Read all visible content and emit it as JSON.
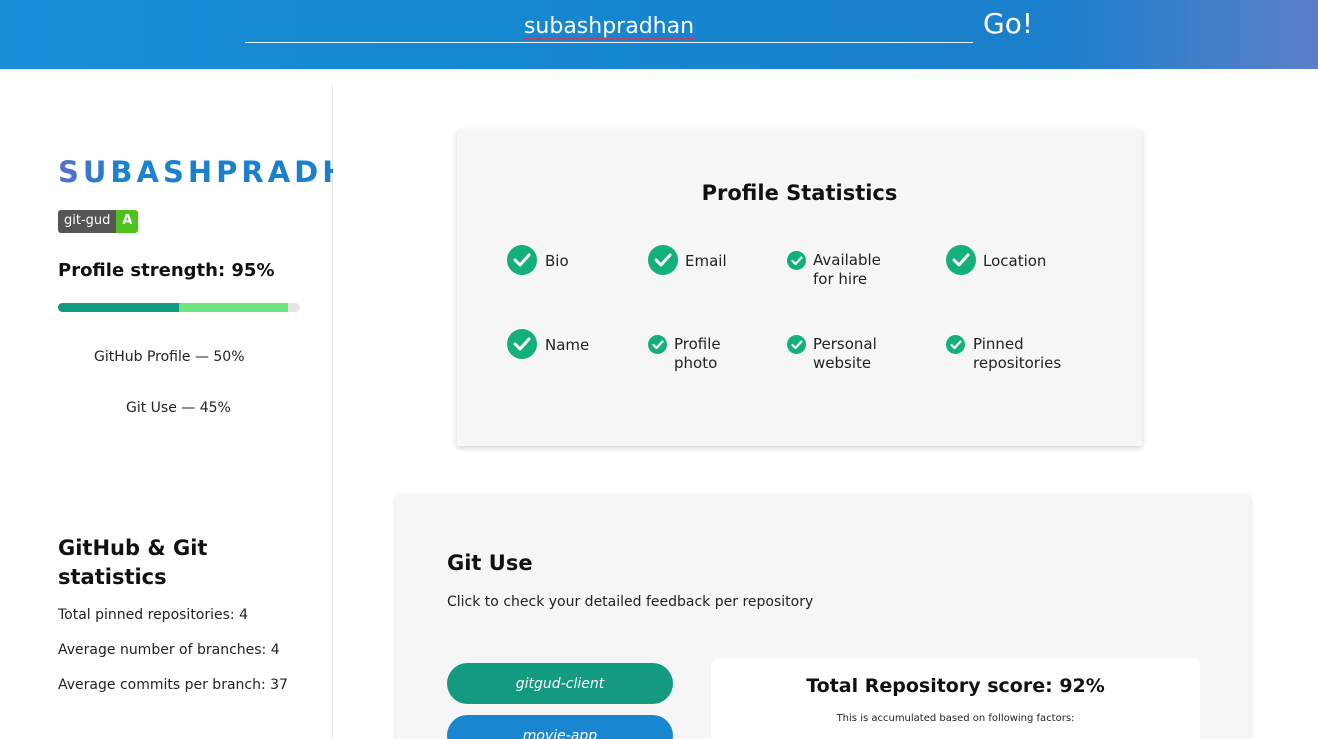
{
  "header": {
    "search_value": "subashpradhan",
    "go_label": "Go!",
    "gradient_colors": [
      "#1a8fd8",
      "#5b7fc8"
    ]
  },
  "sidebar": {
    "username": "SUBASHPRADHAN",
    "badge": {
      "label": "git-gud",
      "grade": "A",
      "grade_color": "#4fc11f"
    },
    "profile_strength": "Profile strength: 95%",
    "strength_bar": {
      "github_fraction": 0.5,
      "git_fraction": 0.45,
      "github_color": "#119a80",
      "git_color": "#6ee581"
    },
    "legend_github": "GitHub Profile — 50%",
    "legend_git": "Git Use — 45%",
    "stats_title": "GitHub & Git statistics",
    "stats": [
      "Total pinned repositories: 4",
      "Average number of branches: 4",
      "Average commits per branch: 37"
    ]
  },
  "profile_statistics": {
    "title": "Profile Statistics",
    "items": [
      "Bio",
      "Email",
      "Available for hire",
      "Location",
      "Name",
      "Profile photo",
      "Personal website",
      "Pinned repositories"
    ],
    "check_color": "#13b07a"
  },
  "git_use": {
    "title": "Git Use",
    "subtitle": "Click to check your detailed feedback per repository",
    "repos": [
      "gitgud-client",
      "movie-app"
    ],
    "score_title": "Total Repository score: 92%",
    "score_subtitle": "This is accumulated based on following factors:"
  }
}
